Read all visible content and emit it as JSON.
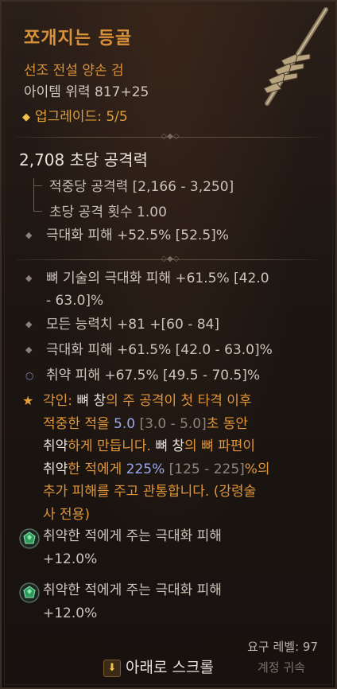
{
  "item": {
    "name": "쪼개지는 등골",
    "type": "선조 전설 양손 검",
    "item_power": "아이템 위력 817+25",
    "upgrades": "업그레이드: 5/5"
  },
  "stats": {
    "dps": "2,708 초당 공격력",
    "damage_per_hit": "적중당 공격력 [2,166 - 3,250]",
    "attacks_per_second": "초당 공격 횟수 1.00",
    "implicit": "극대화 피해 +52.5% [52.5]%"
  },
  "affixes": [
    {
      "line1": "뼈 기술의 극대화 피해 +61.5% [42.0",
      "line2": "- 63.0]%"
    },
    {
      "line1": "모든 능력치 +81 +[60 - 84]"
    },
    {
      "line1": "극대화 피해 +61.5% [42.0 - 63.0]%"
    },
    {
      "line1": "취약 피해 +67.5% [49.5 - 70.5]%"
    }
  ],
  "aspect": {
    "l1_a": "각인: ",
    "l1_b": "뼈 창",
    "l1_c": "의 주 공격이 첫 타격 이후",
    "l2_a": "적중한 적을 ",
    "l2_v": "5.0",
    "l2_g": " [3.0 - 5.0]",
    "l2_b": "초 동안",
    "l3_a": "취약",
    "l3_b": "하게 만듭니다. ",
    "l3_c": "뼈 창",
    "l3_d": "의 뼈 파편이",
    "l4_a": "취약",
    "l4_b": "한 적에게 ",
    "l4_v": "225%",
    "l4_g": " [125 - 225]",
    "l4_c": "%의",
    "l5": "추가 피해를 주고 관통합니다. (강령술",
    "l6": "사 전용)"
  },
  "sockets": [
    {
      "line1": "취약한 적에게 주는 극대화 피해",
      "line2": "+12.0%",
      "icon": "emerald-gem-icon"
    },
    {
      "line1": "취약한 적에게 주는 극대화 피해",
      "line2": "+12.0%",
      "icon": "emerald-gem-icon"
    }
  ],
  "footer": {
    "required_level": "요구 레벨: 97",
    "scroll_key": "⬇",
    "scroll_label": "아래로 스크롤",
    "account_bound": "계정 귀속"
  },
  "colors": {
    "title": "#d9913a",
    "aspect_text": "#e0953a",
    "aspect_value": "#9aa8f0",
    "gem": "#2e9a5a"
  }
}
